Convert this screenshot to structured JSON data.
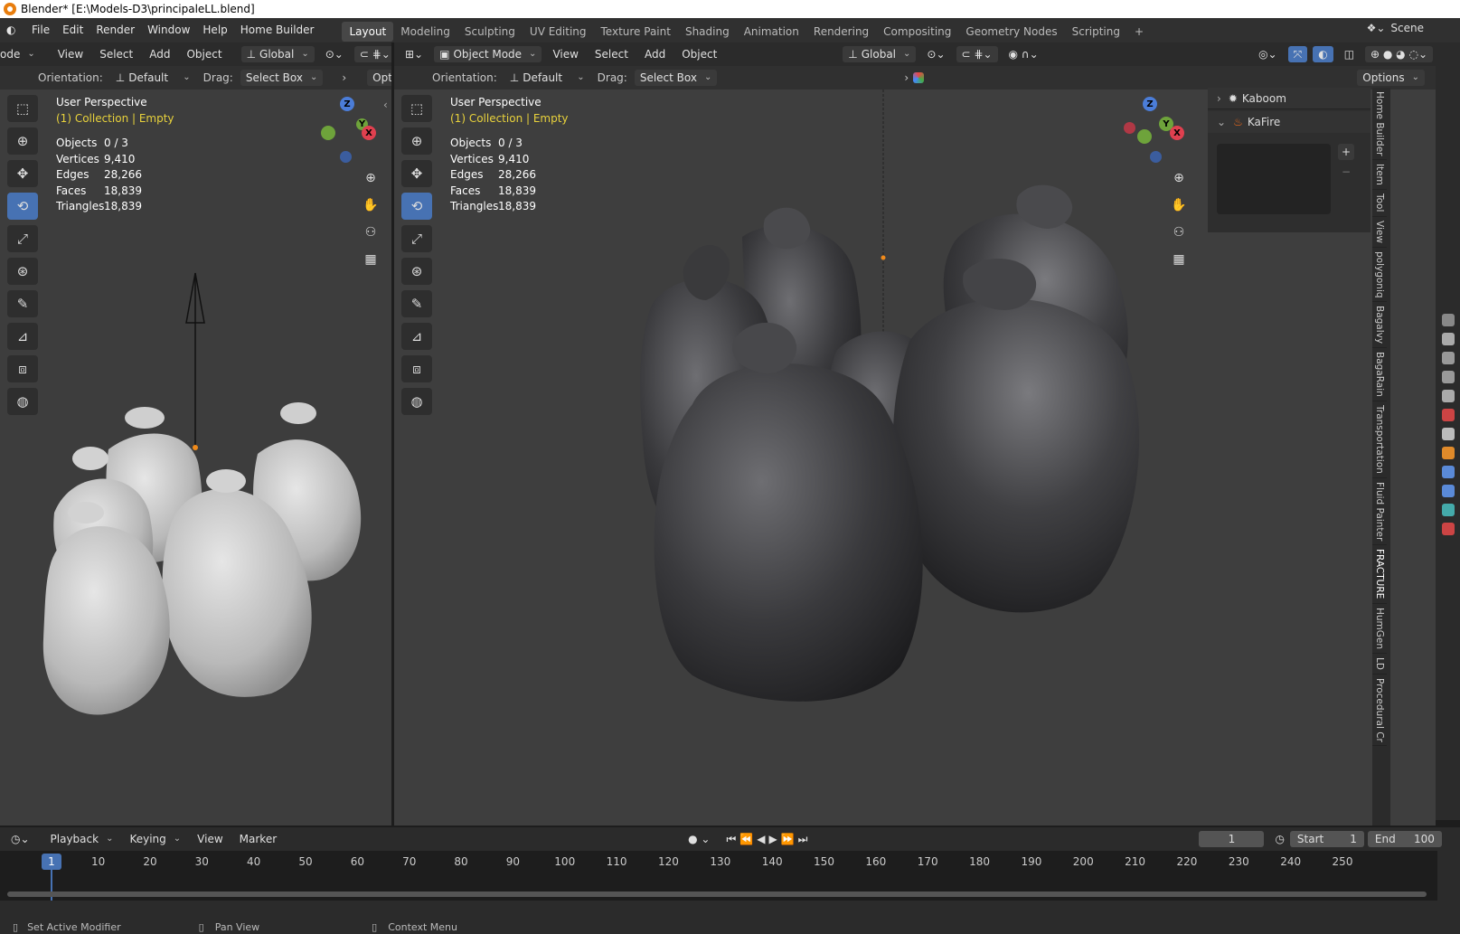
{
  "window": {
    "title": "Blender* [E:\\Models-D3\\principaleLL.blend]"
  },
  "menu": [
    "File",
    "Edit",
    "Render",
    "Window",
    "Help",
    "Home Builder"
  ],
  "workspaces": [
    "Layout",
    "Modeling",
    "Sculpting",
    "UV Editing",
    "Texture Paint",
    "Shading",
    "Animation",
    "Rendering",
    "Compositing",
    "Geometry Nodes",
    "Scripting"
  ],
  "scene": "Scene",
  "left_view": {
    "mode_partial": "ode",
    "header": [
      "View",
      "Select",
      "Add",
      "Object"
    ],
    "transform": "Global",
    "orientation_label": "Orientation:",
    "orientation": "Default",
    "drag_label": "Drag:",
    "drag": "Select Box",
    "options": "Options"
  },
  "right_view": {
    "mode": "Object Mode",
    "header": [
      "View",
      "Select",
      "Add",
      "Object"
    ],
    "transform": "Global",
    "orientation_label": "Orientation:",
    "orientation": "Default",
    "drag_label": "Drag:",
    "drag": "Select Box",
    "options": "Options"
  },
  "overlay": {
    "perspective": "User Perspective",
    "collection": "(1) Collection | Empty",
    "stats": [
      {
        "k": "Objects",
        "v": "0 / 3"
      },
      {
        "k": "Vertices",
        "v": "9,410"
      },
      {
        "k": "Edges",
        "v": "28,266"
      },
      {
        "k": "Faces",
        "v": "18,839"
      },
      {
        "k": "Triangles",
        "v": "18,839"
      }
    ]
  },
  "gizmo": {
    "x": "X",
    "y": "Y",
    "z": "Z"
  },
  "npanel": {
    "items": [
      "Kaboom",
      "KaFire"
    ]
  },
  "side_tabs": [
    "Home Builder",
    "Item",
    "Tool",
    "View",
    "polygoniq",
    "Bagalvy",
    "BagaRain",
    "Transportation",
    "Fluid Painter",
    "FRACTURE",
    "HumGen",
    "LD",
    "Procedural Cr"
  ],
  "timeline": {
    "menu": [
      "Playback",
      "Keying",
      "View",
      "Marker"
    ],
    "current": "1",
    "start_label": "Start",
    "start": "1",
    "end_label": "End",
    "end": "100",
    "ticks": [
      "10",
      "20",
      "30",
      "40",
      "50",
      "60",
      "70",
      "80",
      "90",
      "100",
      "110",
      "120",
      "130",
      "140",
      "150",
      "160",
      "170",
      "180",
      "190",
      "200",
      "210",
      "220",
      "230",
      "240",
      "250"
    ]
  },
  "status": [
    "Set Active Modifier",
    "Pan View",
    "Context Menu"
  ],
  "colors": {
    "accent": "#4772b3",
    "bg": "#3d3d3d",
    "yellow": "#e8d23c"
  }
}
